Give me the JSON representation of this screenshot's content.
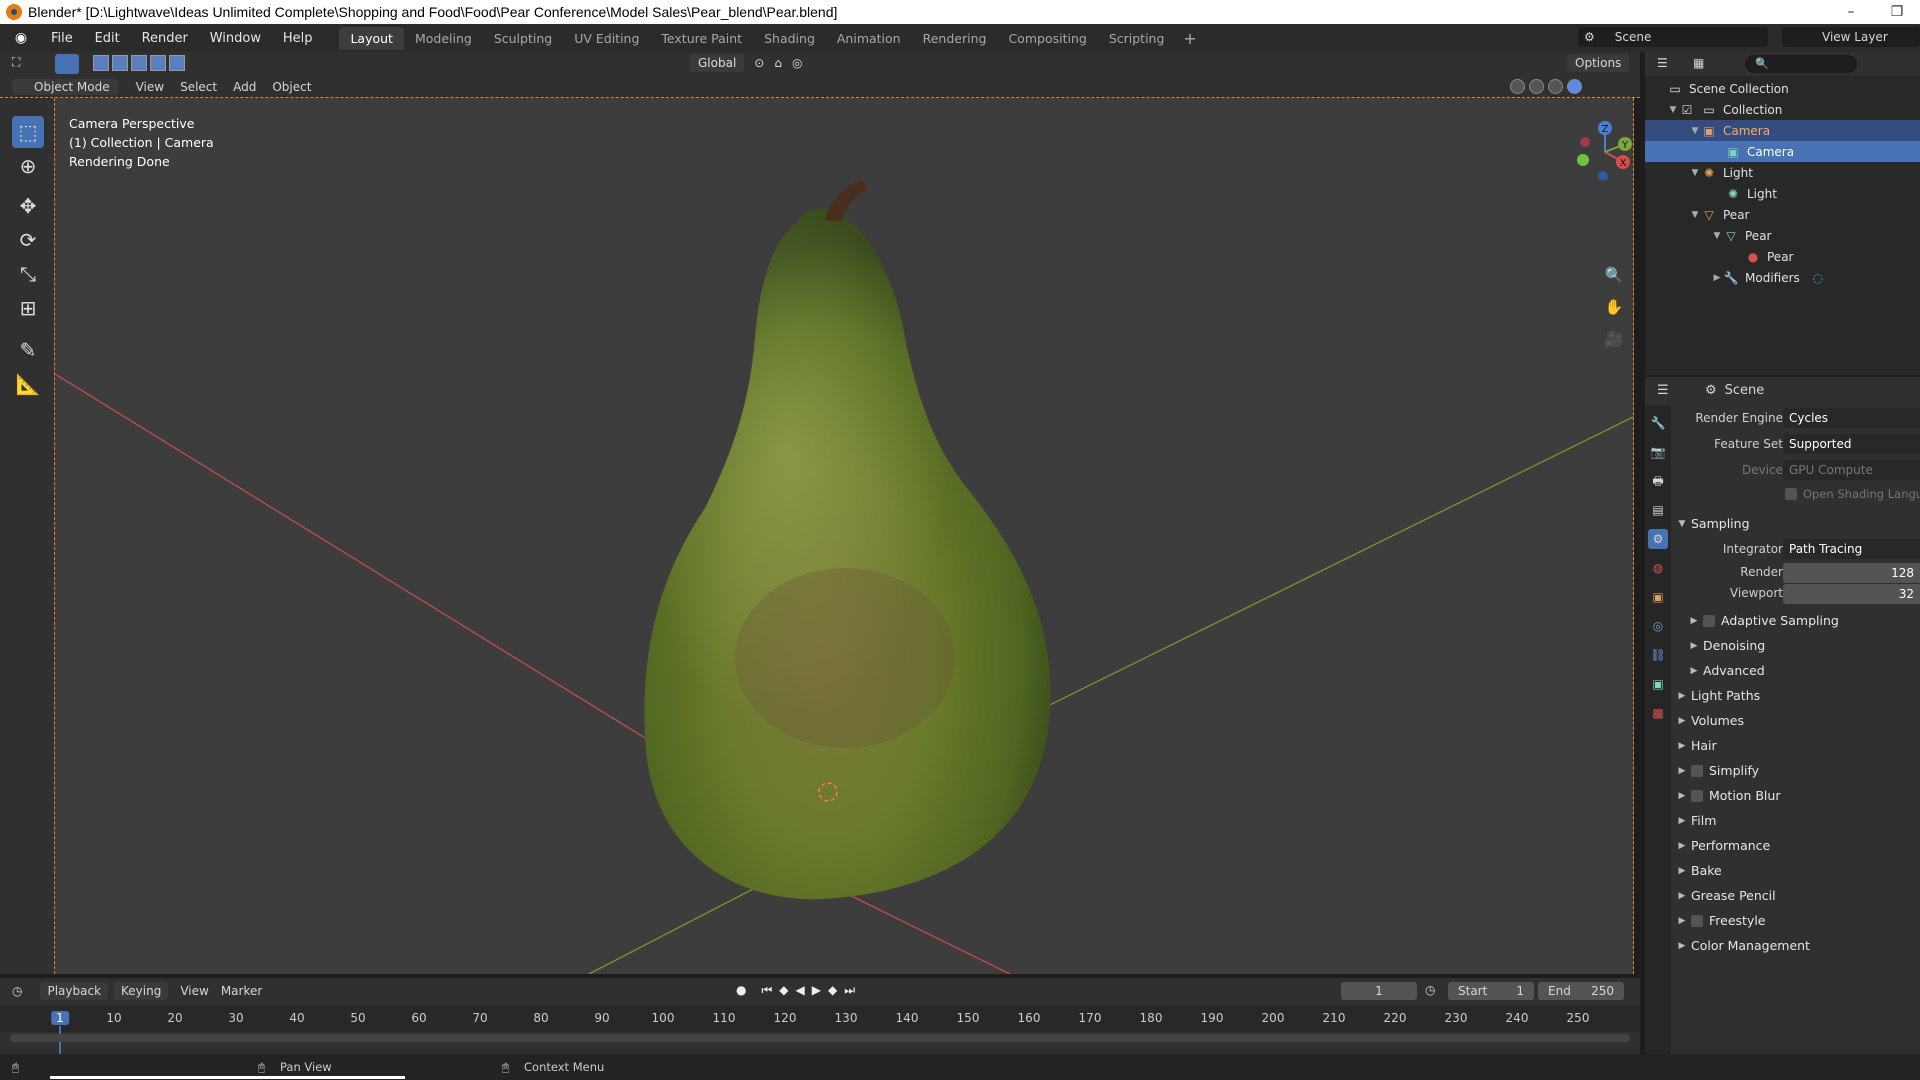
{
  "window": {
    "title": "Blender* [D:\\Lightwave\\Ideas Unlimited Complete\\Shopping and Food\\Food\\Pear Conference\\Model Sales\\Pear_blend\\Pear.blend]",
    "minimize": "–",
    "restore": "❐"
  },
  "menu": [
    "File",
    "Edit",
    "Render",
    "Window",
    "Help"
  ],
  "workspaces": [
    "Layout",
    "Modeling",
    "Sculpting",
    "UV Editing",
    "Texture Paint",
    "Shading",
    "Animation",
    "Rendering",
    "Compositing",
    "Scripting"
  ],
  "workspace_add": "+",
  "scene_name": "Scene",
  "view_layer": "View Layer",
  "viewport_header": {
    "transform_orientation": "Global",
    "options": "Options",
    "mode": "Object Mode",
    "menus": [
      "View",
      "Select",
      "Add",
      "Object"
    ]
  },
  "overlay_text": {
    "line1": "Camera Perspective",
    "line2": "(1) Collection | Camera",
    "line3": "Rendering Done"
  },
  "gizmo": {
    "x": "X",
    "y": "Y",
    "z": "Z"
  },
  "outliner": {
    "rows": [
      {
        "label": "Scene Collection"
      },
      {
        "label": "Collection"
      },
      {
        "label": "Camera"
      },
      {
        "label": "Camera"
      },
      {
        "label": "Light"
      },
      {
        "label": "Light"
      },
      {
        "label": "Pear"
      },
      {
        "label": "Pear"
      },
      {
        "label": "Pear"
      },
      {
        "label": "Modifiers"
      }
    ]
  },
  "properties": {
    "context": "Scene",
    "render_engine_label": "Render Engine",
    "render_engine": "Cycles",
    "feature_set_label": "Feature Set",
    "feature_set": "Supported",
    "device_label": "Device",
    "device": "GPU Compute",
    "osl": "Open Shading Langu",
    "sampling": "Sampling",
    "integrator_label": "Integrator",
    "integrator": "Path Tracing",
    "render_label": "Render",
    "render_samples": "128",
    "viewport_label": "Viewport",
    "viewport_samples": "32",
    "subpanels": [
      "Adaptive Sampling",
      "Denoising",
      "Advanced"
    ],
    "panels": [
      "Light Paths",
      "Volumes",
      "Hair",
      "Simplify",
      "Motion Blur",
      "Film",
      "Performance",
      "Bake",
      "Grease Pencil",
      "Freestyle",
      "Color Management"
    ]
  },
  "timeline": {
    "menus": [
      "Playback",
      "Keying",
      "View",
      "Marker"
    ],
    "current_frame": "1",
    "start_label": "Start",
    "start": "1",
    "end_label": "End",
    "end": "250",
    "ticks": [
      "1",
      "10",
      "20",
      "30",
      "40",
      "50",
      "60",
      "70",
      "80",
      "90",
      "100",
      "110",
      "120",
      "130",
      "140",
      "150",
      "160",
      "170",
      "180",
      "190",
      "200",
      "210",
      "220",
      "230",
      "240",
      "250"
    ]
  },
  "statusbar": {
    "pan": "Pan View",
    "context": "Context Menu"
  },
  "colors": {
    "accent": "#4772b3",
    "active_outline": "#e7832d",
    "x_axis": "#c84a4a",
    "y_axis": "#6f9a2f"
  }
}
